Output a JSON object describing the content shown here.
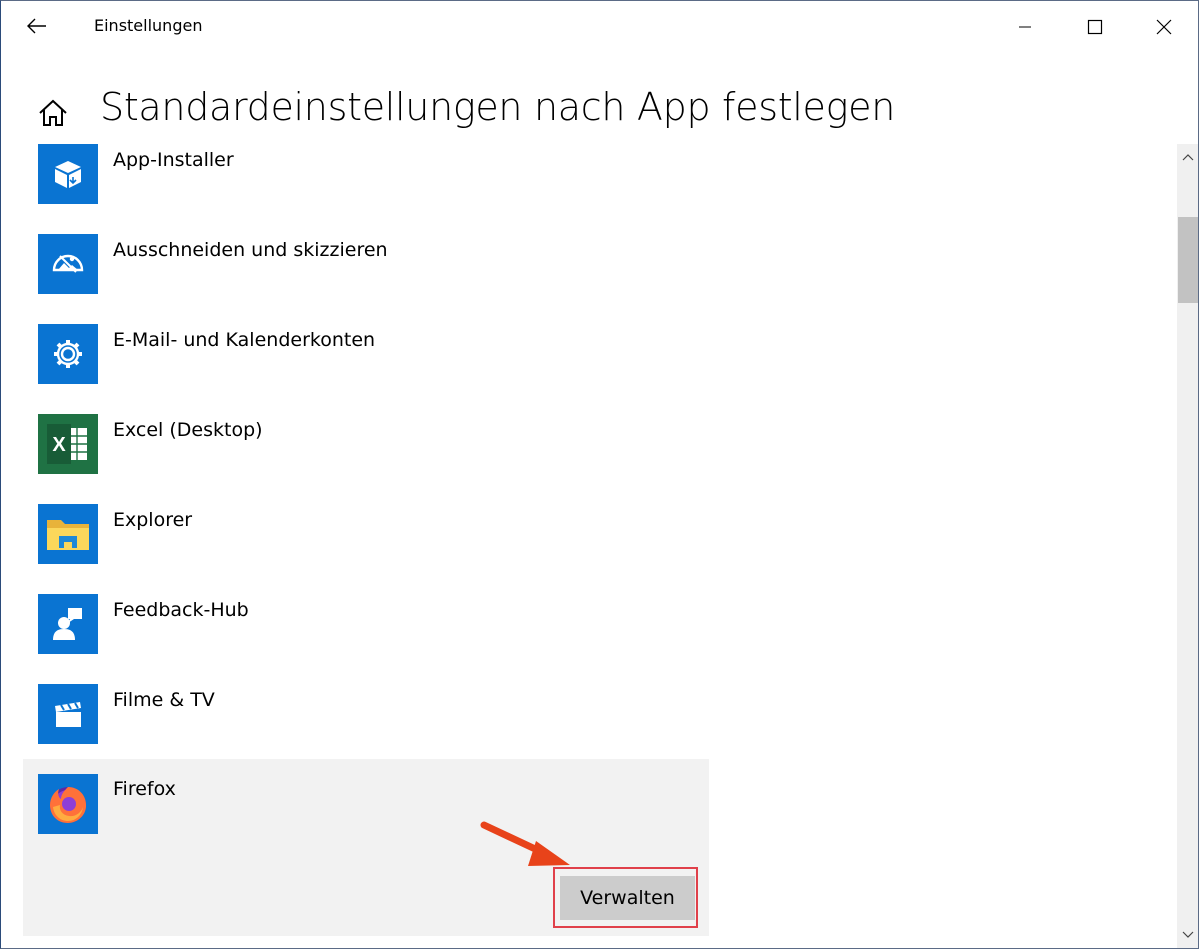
{
  "window": {
    "title": "Einstellungen"
  },
  "page": {
    "title": "Standardeinstellungen nach App festlegen"
  },
  "apps": [
    {
      "name": "App-Installer",
      "icon": "package-icon"
    },
    {
      "name": "Ausschneiden und skizzieren",
      "icon": "snip-sketch-icon"
    },
    {
      "name": "E-Mail- und Kalenderkonten",
      "icon": "gear-icon"
    },
    {
      "name": "Excel (Desktop)",
      "icon": "excel-icon"
    },
    {
      "name": "Explorer",
      "icon": "folder-icon"
    },
    {
      "name": "Feedback-Hub",
      "icon": "feedback-icon"
    },
    {
      "name": "Filme & TV",
      "icon": "clapperboard-icon"
    },
    {
      "name": "Firefox",
      "icon": "firefox-icon"
    }
  ],
  "selected_app": {
    "manage_label": "Verwalten"
  },
  "colors": {
    "tile": "#0a74d2",
    "highlight": "#e0404a",
    "arrow": "#e8431a",
    "selected_bg": "#f2f2f2",
    "button_bg": "#cccccc"
  }
}
